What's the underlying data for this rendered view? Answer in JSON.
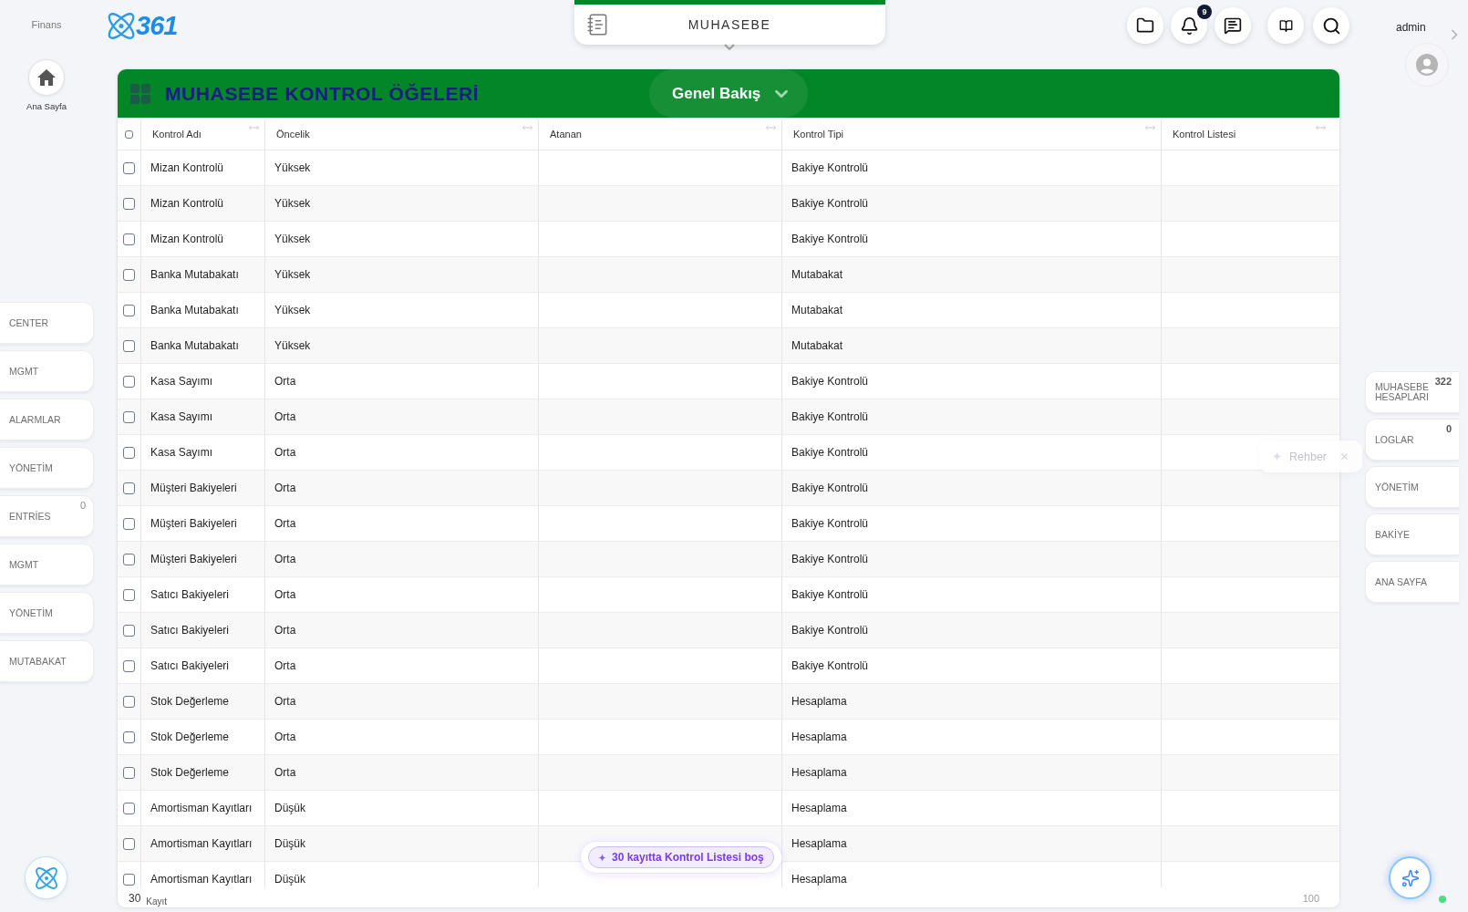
{
  "left_sidebar": {
    "brand": "Finans",
    "home": {
      "label": "Ana Sayfa"
    },
    "tabs": [
      {
        "label": "CENTER"
      },
      {
        "label": "MGMT"
      },
      {
        "label": "ALARMLAR"
      },
      {
        "label": "YÖNETİM"
      },
      {
        "label": "ENTRİES",
        "count": "0"
      },
      {
        "label": "MGMT"
      },
      {
        "label": "YÖNETİM"
      },
      {
        "label": "MUTABAKAT"
      }
    ]
  },
  "logo": {
    "text": "361"
  },
  "module_tab": {
    "label": "MUHASEBE"
  },
  "toolbar": {
    "notification_count": "9"
  },
  "user": {
    "name": "admin"
  },
  "panel": {
    "title": "MUHASEBE KONTROL ÖĞELERİ",
    "view_selector": {
      "label": "Genel Bakış"
    },
    "table": {
      "select_all": {
        "checked": false
      },
      "columns": [
        "Kontrol Adı",
        "Öncelik",
        "Atanan",
        "Kontrol Tipi",
        "Kontrol Listesi"
      ],
      "rows": [
        {
          "checked": false,
          "name": "Mizan Kontrolü",
          "priority": "Yüksek",
          "type": "Bakiye Kontrolü"
        },
        {
          "checked": false,
          "name": "Mizan Kontrolü",
          "priority": "Yüksek",
          "type": "Bakiye Kontrolü"
        },
        {
          "checked": false,
          "name": "Mizan Kontrolü",
          "priority": "Yüksek",
          "type": "Bakiye Kontrolü"
        },
        {
          "checked": false,
          "name": "Banka Mutabakatı",
          "priority": "Yüksek",
          "type": "Mutabakat"
        },
        {
          "checked": false,
          "name": "Banka Mutabakatı",
          "priority": "Yüksek",
          "type": "Mutabakat"
        },
        {
          "checked": false,
          "name": "Banka Mutabakatı",
          "priority": "Yüksek",
          "type": "Mutabakat"
        },
        {
          "checked": false,
          "name": "Kasa Sayımı",
          "priority": "Orta",
          "type": "Bakiye Kontrolü"
        },
        {
          "checked": false,
          "name": "Kasa Sayımı",
          "priority": "Orta",
          "type": "Bakiye Kontrolü"
        },
        {
          "checked": false,
          "name": "Kasa Sayımı",
          "priority": "Orta",
          "type": "Bakiye Kontrolü"
        },
        {
          "checked": false,
          "name": "Müşteri Bakiyeleri",
          "priority": "Orta",
          "type": "Bakiye Kontrolü"
        },
        {
          "checked": false,
          "name": "Müşteri Bakiyeleri",
          "priority": "Orta",
          "type": "Bakiye Kontrolü"
        },
        {
          "checked": false,
          "name": "Müşteri Bakiyeleri",
          "priority": "Orta",
          "type": "Bakiye Kontrolü"
        },
        {
          "checked": false,
          "name": "Satıcı Bakiyeleri",
          "priority": "Orta",
          "type": "Bakiye Kontrolü"
        },
        {
          "checked": false,
          "name": "Satıcı Bakiyeleri",
          "priority": "Orta",
          "type": "Bakiye Kontrolü"
        },
        {
          "checked": false,
          "name": "Satıcı Bakiyeleri",
          "priority": "Orta",
          "type": "Bakiye Kontrolü"
        },
        {
          "checked": false,
          "name": "Stok Değerleme",
          "priority": "Orta",
          "type": "Hesaplama"
        },
        {
          "checked": false,
          "name": "Stok Değerleme",
          "priority": "Orta",
          "type": "Hesaplama"
        },
        {
          "checked": false,
          "name": "Stok Değerleme",
          "priority": "Orta",
          "type": "Hesaplama"
        },
        {
          "checked": false,
          "name": "Amortisman Kayıtları",
          "priority": "Düşük",
          "type": "Hesaplama"
        },
        {
          "checked": false,
          "name": "Amortisman Kayıtları",
          "priority": "Düşük",
          "type": "Hesaplama"
        },
        {
          "checked": false,
          "name": "Amortisman Kayıtları",
          "priority": "Düşük",
          "type": "Hesaplama"
        }
      ]
    },
    "footer": {
      "count": "30",
      "label": "Kayıt",
      "page_size": "100"
    }
  },
  "guide_hint": {
    "label": "Rehber"
  },
  "notice": {
    "text": "30 kayıtta Kontrol Listesi boş"
  },
  "right_sidebar": {
    "tabs": [
      {
        "label": "MUHASEBE HESAPLARI",
        "count": "322"
      },
      {
        "label": "LOGLAR",
        "count": "0"
      },
      {
        "label": "YÖNETİM"
      },
      {
        "label": "BAKİYE"
      },
      {
        "label": "ANA SAYFA"
      }
    ]
  }
}
